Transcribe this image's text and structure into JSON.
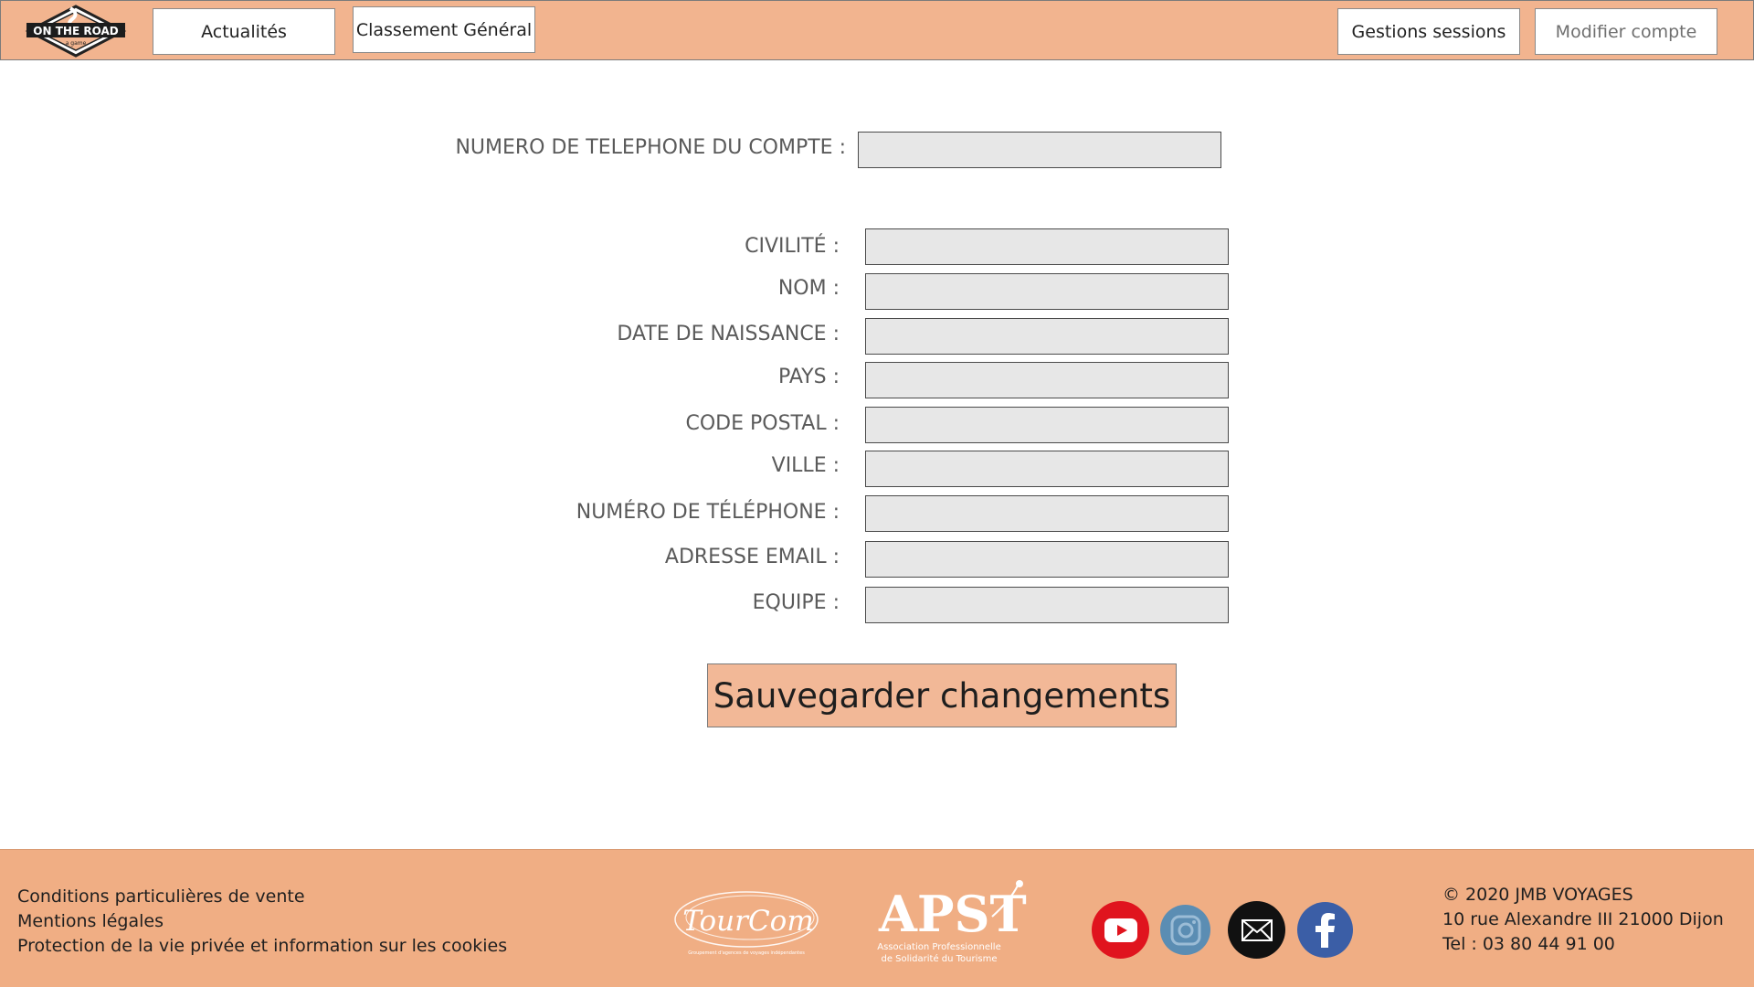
{
  "header": {
    "logo_text": "ON THE ROAD",
    "logo_subtext": "a game",
    "nav": {
      "news": "Actualités",
      "ranking": "Classement Général",
      "sessions": "Gestions sessions",
      "account": "Modifier compte"
    }
  },
  "form": {
    "account_phone_label": "NUMERO DE TELEPHONE DU COMPTE :",
    "fields": {
      "civility": "CIVILITÉ :",
      "last_name": "NOM :",
      "birth_date": "DATE DE NAISSANCE :",
      "country": "PAYS :",
      "postal_code": "CODE POSTAL :",
      "city": "VILLE :",
      "phone": "NUMÉRO DE TÉLÉPHONE :",
      "email": "ADRESSE EMAIL  :",
      "team": "EQUIPE  :"
    },
    "save_label": "Sauvegarder changements"
  },
  "footer": {
    "links": {
      "terms": "Conditions particulières de vente",
      "legal": "Mentions légales",
      "privacy": "Protection de la vie privée et information sur les cookies"
    },
    "partners": {
      "tourcom": "TourCom",
      "tourcom_tagline": "Groupement d'agences de voyages indépendantes",
      "apst": "APST",
      "apst_line1": "Association Professionnelle",
      "apst_line2": "de Solidarité du Tourisme"
    },
    "social_icons": [
      "youtube-icon",
      "instagram-icon",
      "mail-icon",
      "facebook-icon"
    ],
    "contact": {
      "copyright": "© 2020 JMB VOYAGES",
      "address": "10 rue Alexandre III 21000 Dijon",
      "phone": "Tel : 03 80 44 91 00"
    }
  },
  "colors": {
    "header_bg": "#f2b48f",
    "footer_bg": "#f0ae84",
    "field_bg": "#e7e7e7",
    "youtube": "#e0141e",
    "instagram": "#5b8db3",
    "mail": "#111111",
    "facebook": "#3b5ea6"
  }
}
